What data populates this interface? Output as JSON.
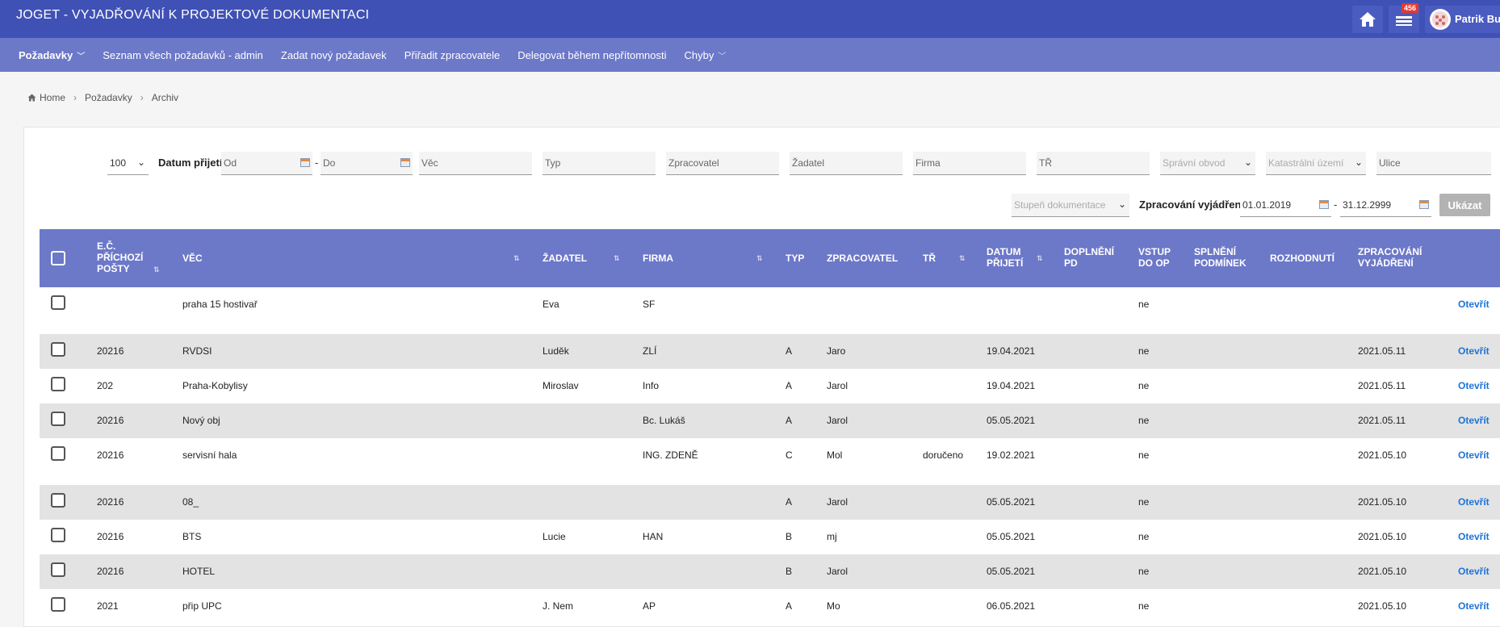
{
  "header": {
    "title": "JOGET - VYJADŘOVÁNÍ K PROJEKTOVÉ DOKUMENTACI",
    "notification_count": "456",
    "user_name": "Patrik Burga"
  },
  "nav": {
    "items": [
      {
        "label": "Požadavky",
        "bold": true,
        "dropdown": true
      },
      {
        "label": "Seznam všech požadavků - admin"
      },
      {
        "label": "Zadat nový požadavek"
      },
      {
        "label": "Přiřadit zpracovatele"
      },
      {
        "label": "Delegovat během nepřítomnosti"
      },
      {
        "label": "Chyby",
        "dropdown": true
      }
    ]
  },
  "breadcrumb": [
    "Home",
    "Požadavky",
    "Archiv"
  ],
  "filters": {
    "page_size": "100",
    "date_label": "Datum přijetí",
    "od_placeholder": "Od",
    "do_placeholder": "Do",
    "vec": "Věc",
    "typ": "Typ",
    "zpracovatel": "Zpracovatel",
    "zadatel": "Žadatel",
    "firma": "Firma",
    "tr": "TŘ",
    "spravni_obvod": "Správní obvod",
    "katastralni_uzemi": "Katastrální území",
    "ulice": "Ulice",
    "stupen_dokumentace": "Stupeň dokumentace",
    "zpracovani_label": "Zpracování vyjádření",
    "date_from": "01.01.2019",
    "date_to": "31.12.2999",
    "show_button": "Ukázat"
  },
  "table": {
    "headers": {
      "ec": "E.Č. PŘÍCHOZÍ POŠTY",
      "vec": "VĚC",
      "zadatel": "ŽADATEL",
      "firma": "FIRMA",
      "typ": "TYP",
      "zpracovatel": "ZPRACOVATEL",
      "tr": "TŘ",
      "datum": "DATUM PŘIJETÍ",
      "doplneni": "DOPLNĚNÍ PD",
      "vstup": "VSTUP DO OP",
      "splneni": "SPLNĚNÍ PODMÍNEK",
      "rozhodnuti": "ROZHODNUTÍ",
      "zpracovani": "ZPRACOVÁNÍ VYJÁDŘENÍ"
    },
    "rows": [
      {
        "ec": "",
        "vec": "praha 15 hostivař",
        "zadatel": "Eva",
        "firma": "SF",
        "typ": "",
        "zpracovatel": "",
        "tr": "",
        "datum": "",
        "doplneni": "",
        "vstup": "ne",
        "splneni": "",
        "rozhodnuti": "",
        "zpracovani": "",
        "action": "Otevřít"
      },
      {
        "ec": "20216",
        "vec": "RVDSI",
        "zadatel": "Luděk",
        "firma": "ZLÍ",
        "typ": "A",
        "zpracovatel": "Jaro",
        "tr": "",
        "datum": "19.04.2021",
        "doplneni": "",
        "vstup": "ne",
        "splneni": "",
        "rozhodnuti": "",
        "zpracovani": "2021.05.11",
        "action": "Otevřít"
      },
      {
        "ec": "202",
        "vec": "Praha-Kobylisy",
        "zadatel": "Miroslav",
        "firma": "Info",
        "typ": "A",
        "zpracovatel": "Jarol",
        "tr": "",
        "datum": "19.04.2021",
        "doplneni": "",
        "vstup": "ne",
        "splneni": "",
        "rozhodnuti": "",
        "zpracovani": "2021.05.11",
        "action": "Otevřít"
      },
      {
        "ec": "20216",
        "vec": "Nový obj",
        "zadatel": "",
        "firma": "Bc. Lukáš",
        "typ": "A",
        "zpracovatel": "Jarol",
        "tr": "",
        "datum": "05.05.2021",
        "doplneni": "",
        "vstup": "ne",
        "splneni": "",
        "rozhodnuti": "",
        "zpracovani": "2021.05.11",
        "action": "Otevřít"
      },
      {
        "ec": "20216",
        "vec": "servisní hala",
        "zadatel": "",
        "firma": "ING. ZDENĚ",
        "typ": "C",
        "zpracovatel": "Mol",
        "tr": "doručeno",
        "datum": "19.02.2021",
        "doplneni": "",
        "vstup": "ne",
        "splneni": "",
        "rozhodnuti": "",
        "zpracovani": "2021.05.10",
        "action": "Otevřít"
      },
      {
        "ec": "20216",
        "vec": "08_",
        "zadatel": "",
        "firma": "",
        "typ": "A",
        "zpracovatel": "Jarol",
        "tr": "",
        "datum": "05.05.2021",
        "doplneni": "",
        "vstup": "ne",
        "splneni": "",
        "rozhodnuti": "",
        "zpracovani": "2021.05.10",
        "action": "Otevřít"
      },
      {
        "ec": "20216",
        "vec": "BTS",
        "zadatel": "Lucie",
        "firma": "HAN",
        "typ": "B",
        "zpracovatel": "mj",
        "tr": "",
        "datum": "05.05.2021",
        "doplneni": "",
        "vstup": "ne",
        "splneni": "",
        "rozhodnuti": "",
        "zpracovani": "2021.05.10",
        "action": "Otevřít"
      },
      {
        "ec": "20216",
        "vec": "HOTEL",
        "zadatel": "",
        "firma": "",
        "typ": "B",
        "zpracovatel": "Jarol",
        "tr": "",
        "datum": "05.05.2021",
        "doplneni": "",
        "vstup": "ne",
        "splneni": "",
        "rozhodnuti": "",
        "zpracovani": "2021.05.10",
        "action": "Otevřít"
      },
      {
        "ec": "2021",
        "vec": "přip UPC",
        "zadatel": "J. Nem",
        "firma": "AP",
        "typ": "A",
        "zpracovatel": "Mo",
        "tr": "",
        "datum": "06.05.2021",
        "doplneni": "",
        "vstup": "ne",
        "splneni": "",
        "rozhodnuti": "",
        "zpracovani": "2021.05.10",
        "action": "Otevřít"
      }
    ]
  }
}
